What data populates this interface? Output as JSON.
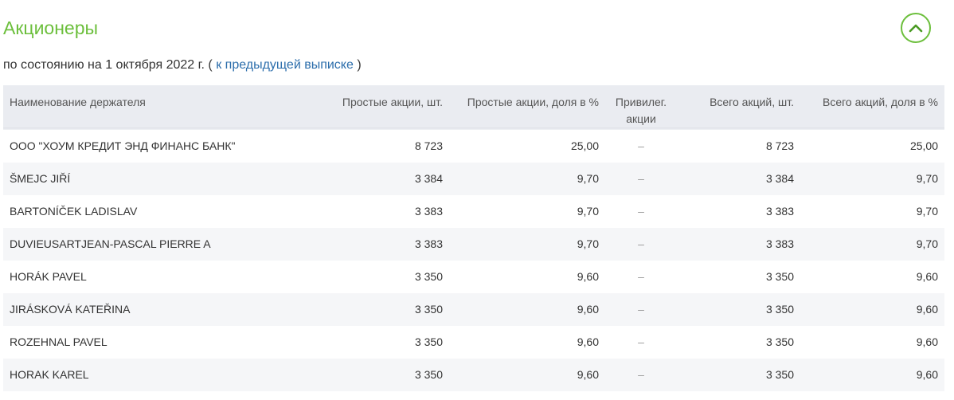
{
  "section": {
    "title": "Акционеры",
    "subtitle_prefix": "по состоянию на 1 октября 2022 г. (",
    "subtitle_link": "к предыдущей выписке",
    "subtitle_suffix": ")"
  },
  "colors": {
    "accent": "#6cbf3c",
    "link": "#2b6dab",
    "header_bg": "#eaecf1"
  },
  "icons": {
    "collapse": "chevron-up-icon"
  },
  "table": {
    "headers": {
      "holder": "Наименование держателя",
      "common_count": "Простые акции, шт.",
      "common_share": "Простые акции, доля в %",
      "preferred_line1": "Привилег.",
      "preferred_line2": "акции",
      "total_count": "Всего акций, шт.",
      "total_share": "Всего акций, доля в %"
    },
    "rows": [
      {
        "holder": "ООО \"ХОУМ КРЕДИТ ЭНД ФИНАНС БАНК\"",
        "common_count": "8 723",
        "common_share": "25,00",
        "preferred": "–",
        "total_count": "8 723",
        "total_share": "25,00"
      },
      {
        "holder": "ŠMEJC JIŘÍ",
        "common_count": "3 384",
        "common_share": "9,70",
        "preferred": "–",
        "total_count": "3 384",
        "total_share": "9,70"
      },
      {
        "holder": "BARTONÍČEK LADISLAV",
        "common_count": "3 383",
        "common_share": "9,70",
        "preferred": "–",
        "total_count": "3 383",
        "total_share": "9,70"
      },
      {
        "holder": "DUVIEUSARTJEAN-PASCAL PIERRE A",
        "common_count": "3 383",
        "common_share": "9,70",
        "preferred": "–",
        "total_count": "3 383",
        "total_share": "9,70"
      },
      {
        "holder": "HORÁK PAVEL",
        "common_count": "3 350",
        "common_share": "9,60",
        "preferred": "–",
        "total_count": "3 350",
        "total_share": "9,60"
      },
      {
        "holder": "JIRÁSKOVÁ KATEŘINA",
        "common_count": "3 350",
        "common_share": "9,60",
        "preferred": "–",
        "total_count": "3 350",
        "total_share": "9,60"
      },
      {
        "holder": "ROZEHNAL PAVEL",
        "common_count": "3 350",
        "common_share": "9,60",
        "preferred": "–",
        "total_count": "3 350",
        "total_share": "9,60"
      },
      {
        "holder": "HORAK KAREL",
        "common_count": "3 350",
        "common_share": "9,60",
        "preferred": "–",
        "total_count": "3 350",
        "total_share": "9,60"
      }
    ]
  }
}
